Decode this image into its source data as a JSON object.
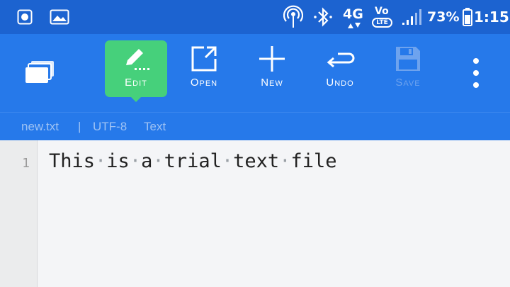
{
  "status": {
    "network": "4G",
    "volte_top": "Vo",
    "volte_bottom": "LTE",
    "battery": "73%",
    "time": "1:15"
  },
  "toolbar": {
    "edit": "Edit",
    "open": "Open",
    "new": "New",
    "undo": "Undo",
    "save": "Save"
  },
  "info": {
    "filename": "new.txt",
    "separator": "|",
    "encoding": "UTF-8",
    "mode": "Text"
  },
  "editor": {
    "line_number": "1",
    "words": [
      "This",
      "is",
      "a",
      "trial",
      "text",
      "file"
    ],
    "whitespace_marker": "·"
  },
  "colors": {
    "status_bar": "#1c63d0",
    "toolbar": "#2679ea",
    "active_tool": "#46d07b",
    "disabled": "#6ea3ee"
  }
}
